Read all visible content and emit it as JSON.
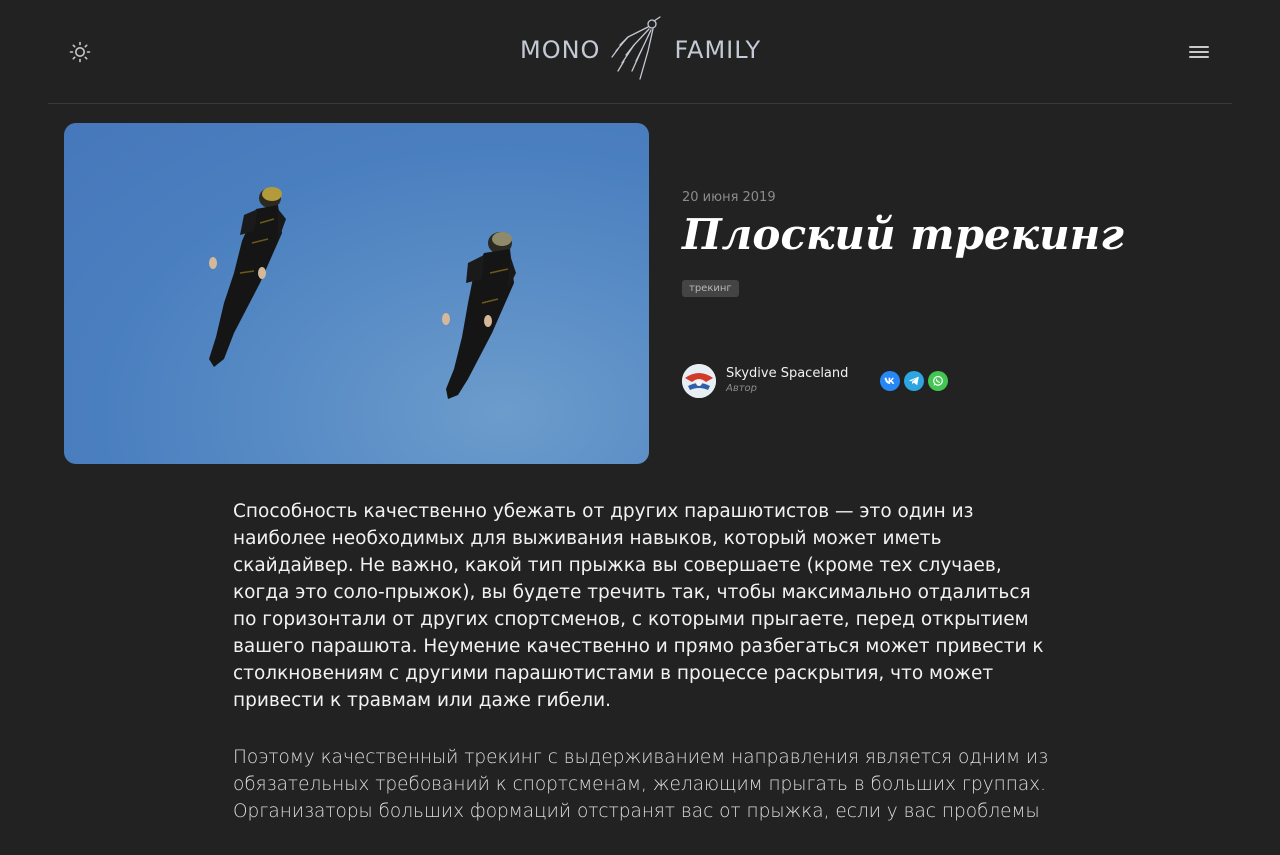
{
  "header": {
    "logo_left": "MONO",
    "logo_right": "FAMILY"
  },
  "post": {
    "date": "20 июня 2019",
    "title": "Плоский трекинг",
    "tag": "трекинг",
    "author": {
      "name": "Skydive Spaceland",
      "role": "Автор"
    },
    "share": [
      "vk",
      "telegram",
      "whatsapp"
    ]
  },
  "article": {
    "paragraphs": [
      "Способность качественно убежать от других парашютистов — это один из наиболее необходимых для выживания навыков, который может иметь скайдайвер. Не важно, какой тип прыжка вы совершаете (кроме тех случаев, когда это соло-прыжок), вы будете тречить так, чтобы максимально отдалиться по горизонтали от других спортсменов, с которыми прыгаете, перед открытием вашего парашюта. Неумение качественно и прямо разбегаться может привести к столкновениям с другими парашютистами в процессе раскрытия, что может привести к травмам или даже гибели.",
      "Поэтому качественный трекинг с выдерживанием направления является одним из обязательных требований к спортсменам, желающим прыгать в больших группах. Организаторы больших формаций отстранят вас от прыжка, если у вас проблемы"
    ]
  },
  "colors": {
    "background": "#222222",
    "sky": "#4a7fbf",
    "vk": "#2787f5",
    "telegram": "#2ca5e0",
    "whatsapp": "#43c553"
  },
  "icons": {
    "theme": "sun-icon",
    "menu": "hamburger-icon",
    "logo": "wingsuit-flyer-icon"
  }
}
